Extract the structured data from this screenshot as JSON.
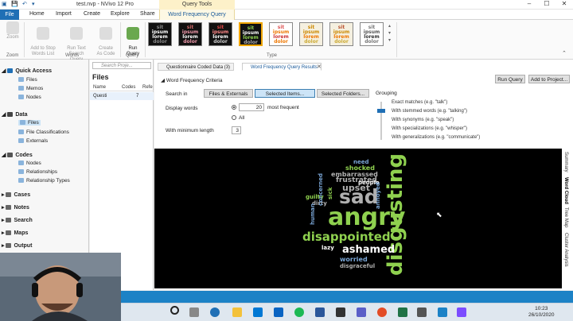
{
  "titlebar": {
    "title": "test.nvp - NVivo 12 Pro",
    "query_tools": "Query Tools",
    "minimize": "–",
    "maximize": "☐",
    "close": "✕"
  },
  "tabs": {
    "file": "File",
    "home": "Home",
    "import": "Import",
    "create": "Create",
    "explore": "Explore",
    "share": "Share",
    "word_frequency_query": "Word Frequency Query"
  },
  "ribbon": {
    "zoom": "Zoom",
    "group_zoom": "Zoom",
    "add_to_stop": "Add to Stop\nWords List",
    "run_text_search": "Run Text\nSearch Query",
    "create_as_code": "Create\nAs Code",
    "group_words": "Words",
    "run_query": "Run\nQuery",
    "group_query": "Query",
    "group_type": "Type",
    "thumbnail_words": [
      "sit",
      "ipsum",
      "lorem",
      "dolor"
    ]
  },
  "nav": {
    "quick_access": "Quick Access",
    "files": "Files",
    "memos": "Memos",
    "nodes_qa": "Nodes",
    "data": "Data",
    "data_files": "Files",
    "file_classifications": "File Classifications",
    "externals": "Externals",
    "codes": "Codes",
    "codes_nodes": "Nodes",
    "relationships": "Relationships",
    "relationship_types": "Relationship Types",
    "cases": "Cases",
    "notes": "Notes",
    "search": "Search",
    "maps": "Maps",
    "output": "Output"
  },
  "files_pane": {
    "search_placeholder": "Search Proje...",
    "header": "Files",
    "columns": {
      "name": "Name",
      "codes": "Codes",
      "refs": "Refe"
    },
    "row": {
      "name": "Questi",
      "codes": "7"
    }
  },
  "detail": {
    "tab1": "Questionnaire Coded Data (3)",
    "tab2": "Word Frequency Query Results",
    "criteria_header": "Word Frequency Criteria",
    "search_in": "Search in",
    "files_externals": "Files & Externals",
    "selected_items": "Selected Items...",
    "selected_folders": "Selected Folders...",
    "grouping": "Grouping",
    "display_words": "Display words",
    "display_count": "20",
    "most_frequent": "most frequent",
    "all": "All",
    "min_length_label": "With minimum length",
    "min_length": "3",
    "run_query": "Run Query",
    "add_to_project": "Add to Project...",
    "grouping_options": [
      "Exact matches (e.g. \"talk\")",
      "With stemmed words (e.g. \"talking\")",
      "With synonyms (e.g. \"speak\")",
      "With specializations (e.g. \"whisper\")",
      "With generalizations (e.g. \"communicate\")"
    ],
    "side_tabs": [
      "Summary",
      "Word Cloud",
      "Tree Map",
      "Cluster Analysis"
    ]
  },
  "word_cloud": {
    "words": [
      {
        "text": "disgusting",
        "color": "#8fd14f"
      },
      {
        "text": "angry",
        "color": "#8fd14f"
      },
      {
        "text": "sad",
        "color": "#b0b0b0"
      },
      {
        "text": "disappointed",
        "color": "#8fd14f"
      },
      {
        "text": "ashamed",
        "color": "#ffffff"
      },
      {
        "text": "upset",
        "color": "#b0b0b0"
      },
      {
        "text": "frustrated",
        "color": "#b0b0b0"
      },
      {
        "text": "embarrassed",
        "color": "#b0b0b0"
      },
      {
        "text": "shocked",
        "color": "#8fd14f"
      },
      {
        "text": "need",
        "color": "#7aa6d6"
      },
      {
        "text": "people",
        "color": "#ffffff"
      },
      {
        "text": "guilty",
        "color": "#8fd14f"
      },
      {
        "text": "dirty",
        "color": "#b0b0b0"
      },
      {
        "text": "concerned",
        "color": "#7aa6d6"
      },
      {
        "text": "sick",
        "color": "#8fd14f"
      },
      {
        "text": "annoyed",
        "color": "#7aa6d6"
      },
      {
        "text": "lazy",
        "color": "#ffffff"
      },
      {
        "text": "worried",
        "color": "#7aa6d6"
      },
      {
        "text": "disgraceful",
        "color": "#b0b0b0"
      },
      {
        "text": "human",
        "color": "#7aa6d6"
      }
    ]
  },
  "clock": {
    "time": "10:23",
    "date": "26/10/2020"
  },
  "colors": {
    "accent": "#1f6fb5",
    "status": "#1c82c6",
    "green": "#8fd14f"
  }
}
